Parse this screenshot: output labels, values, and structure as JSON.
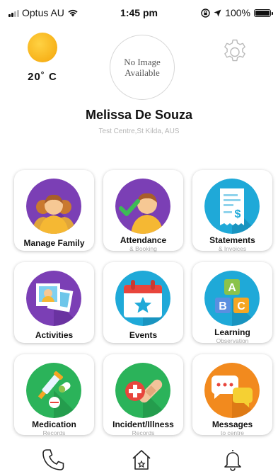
{
  "status_bar": {
    "carrier": "Optus AU",
    "time": "1:45 pm",
    "battery": "100%"
  },
  "weather": {
    "temperature": "20˚ C",
    "icon": "sun-icon"
  },
  "profile": {
    "placeholder_line1": "No Image",
    "placeholder_line2": "Available",
    "name": "Melissa De Souza",
    "location": "Test Centre,St Kilda, AUS"
  },
  "tiles": [
    {
      "title": "Manage Family",
      "subtitle": "",
      "icon": "family-icon",
      "color": "#7b3fb5"
    },
    {
      "title": "Attendance",
      "subtitle": "& Booking",
      "icon": "attendance-icon",
      "color": "#7b3fb5"
    },
    {
      "title": "Statements",
      "subtitle": "& Invoices",
      "icon": "statements-icon",
      "color": "#1fa9d8"
    },
    {
      "title": "Activities",
      "subtitle": "",
      "icon": "activities-icon",
      "color": "#7b3fb5"
    },
    {
      "title": "Events",
      "subtitle": "",
      "icon": "events-icon",
      "color": "#1fa9d8"
    },
    {
      "title": "Learning",
      "subtitle": "Observation",
      "icon": "learning-icon",
      "color": "#1fa9d8"
    },
    {
      "title": "Medication",
      "subtitle": "Records",
      "icon": "medication-icon",
      "color": "#2bb35a"
    },
    {
      "title": "Incident/Illness",
      "subtitle": "Records",
      "icon": "incident-icon",
      "color": "#2bb35a"
    },
    {
      "title": "Messages",
      "subtitle": "to centre",
      "icon": "messages-icon",
      "color": "#f28a1e"
    }
  ],
  "bottom_nav": {
    "items": [
      "phone-icon",
      "home-icon",
      "bell-icon"
    ]
  }
}
